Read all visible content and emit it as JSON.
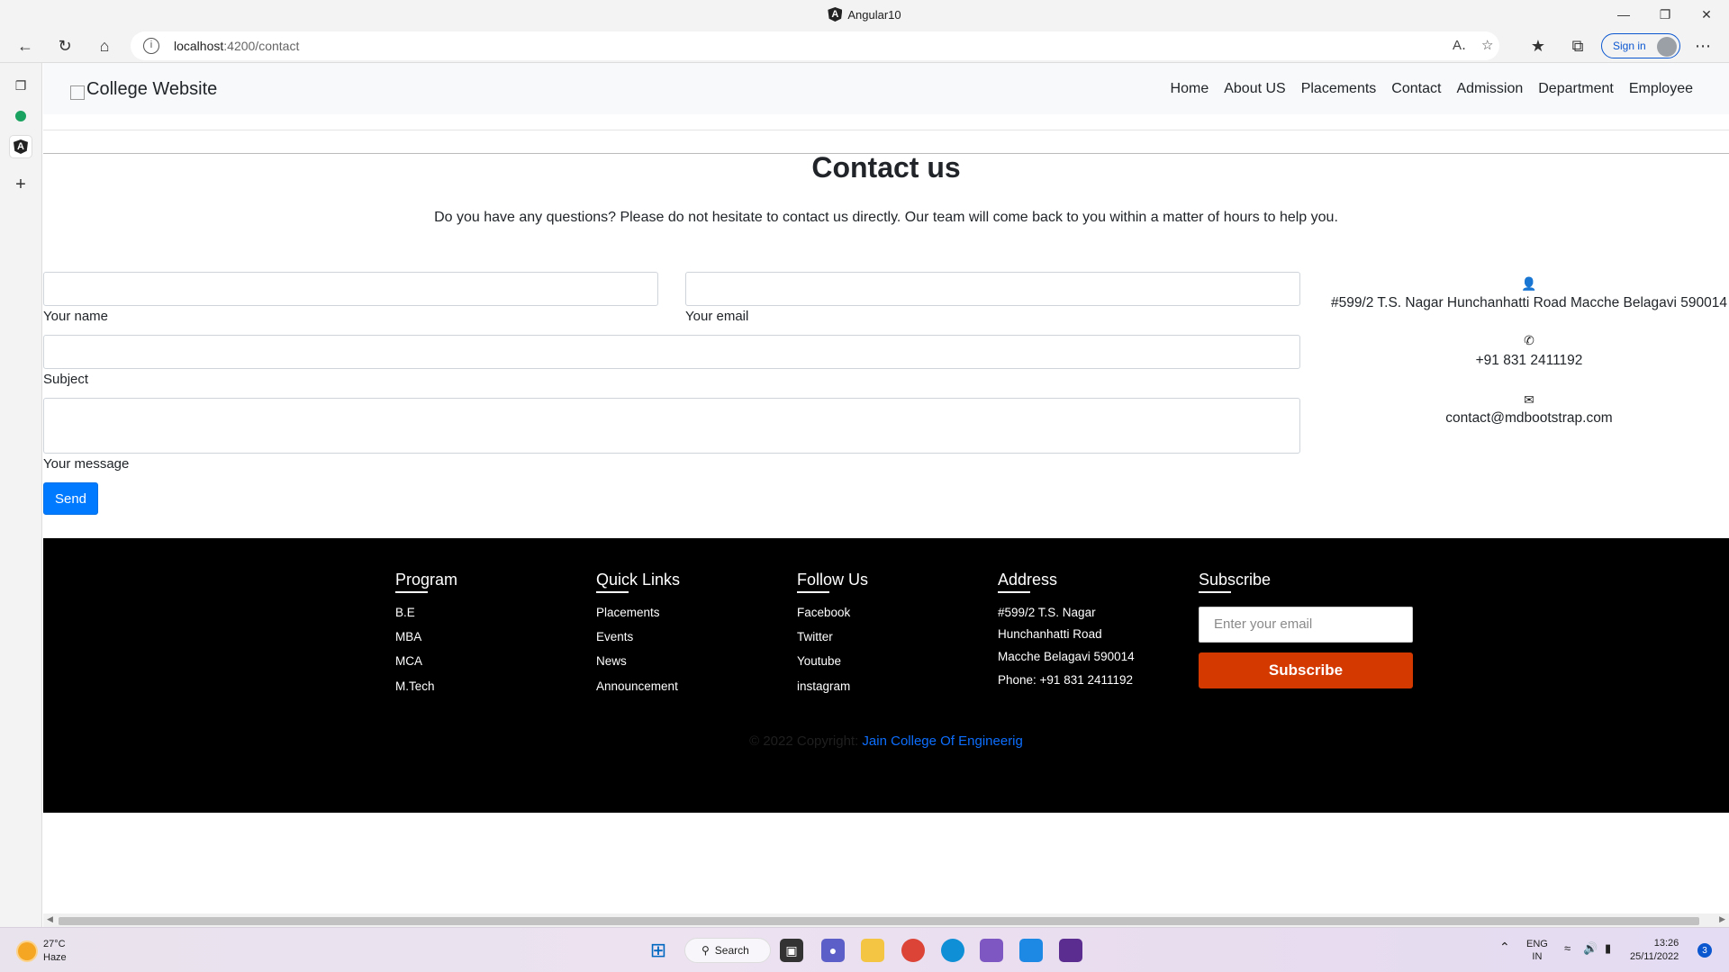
{
  "window": {
    "title": "Angular10",
    "logo_letter": "A"
  },
  "browser": {
    "url_host": "localhost",
    "url_path": ":4200/contact",
    "sign_in_label": "Sign in"
  },
  "site": {
    "brand": "College Website",
    "menu": [
      "Home",
      "About US",
      "Placements",
      "Contact",
      "Admission",
      "Department",
      "Employee"
    ]
  },
  "contact": {
    "title": "Contact us",
    "subtitle": "Do you have any questions? Please do not hesitate to contact us directly. Our team will come back to you within a matter of hours to help you.",
    "labels": {
      "name": "Your name",
      "email": "Your email",
      "subject": "Subject",
      "message": "Your message"
    },
    "send_label": "Send",
    "address": "#599/2 T.S. Nagar Hunchanhatti Road Macche Belagavi 590014",
    "phone": "+91 831 2411192",
    "email": "contact@mdbootstrap.com"
  },
  "footer": {
    "program": {
      "heading": "Program",
      "items": [
        "B.E",
        "MBA",
        "MCA",
        "M.Tech"
      ]
    },
    "quick_links": {
      "heading": "Quick Links",
      "items": [
        "Placements",
        "Events",
        "News",
        "Announcement"
      ]
    },
    "follow_us": {
      "heading": "Follow Us",
      "items": [
        "Facebook",
        "Twitter",
        "Youtube",
        "instagram"
      ]
    },
    "address": {
      "heading": "Address",
      "line1": "#599/2 T.S. Nagar Hunchanhatti Road",
      "line2": "Macche Belagavi 590014",
      "line3": "Phone: +91 831 2411192"
    },
    "subscribe": {
      "heading": "Subscribe",
      "placeholder": "Enter your email",
      "button": "Subscribe"
    },
    "copyright_prefix": "© 2022 Copyright:",
    "copyright_link": "Jain College Of Engineerig"
  },
  "taskbar": {
    "temperature": "27°C",
    "weather": "Haze",
    "search_label": "Search",
    "lang_line1": "ENG",
    "lang_line2": "IN",
    "time": "13:26",
    "date": "25/11/2022",
    "notifications": "3"
  },
  "colors": {
    "primary_button": "#007bff",
    "subscribe_button": "#d43900",
    "footer_bg": "#000000",
    "link": "#0d6efd"
  }
}
